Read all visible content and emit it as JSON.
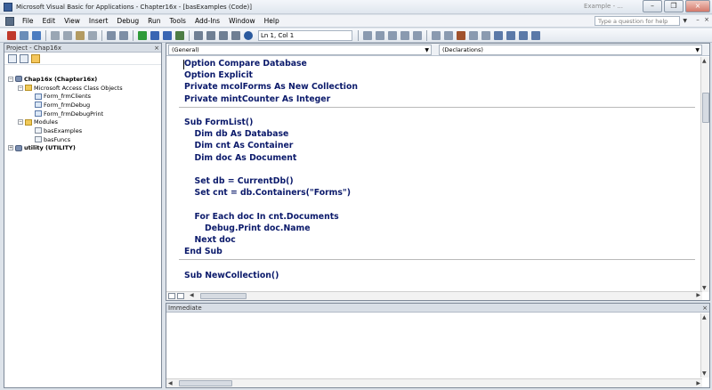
{
  "window": {
    "title": "Microsoft Visual Basic for Applications - Chapter16x - [basExamples (Code)]",
    "titlebar_right": "Example - ..."
  },
  "menu": {
    "items": [
      "File",
      "Edit",
      "View",
      "Insert",
      "Debug",
      "Run",
      "Tools",
      "Add-Ins",
      "Window",
      "Help"
    ],
    "ask_placeholder": "Type a question for help",
    "doc_buttons": [
      "–",
      "×"
    ]
  },
  "toolbar": {
    "position": "Ln 1, Col 1"
  },
  "project_pane": {
    "title": "Project - Chap16x",
    "close": "×",
    "tree": [
      {
        "label": "Chap16x (Chapter16x)",
        "level": 0,
        "icon": "project-icon",
        "toggle": "−",
        "bold": true
      },
      {
        "label": "Microsoft Access Class Objects",
        "level": 1,
        "icon": "folder-icon",
        "toggle": "−",
        "bold": false
      },
      {
        "label": "Form_frmClients",
        "level": 2,
        "icon": "form-icon",
        "toggle": "",
        "bold": false
      },
      {
        "label": "Form_frmDebug",
        "level": 2,
        "icon": "form-icon",
        "toggle": "",
        "bold": false
      },
      {
        "label": "Form_frmDebugPrint",
        "level": 2,
        "icon": "form-icon",
        "toggle": "",
        "bold": false
      },
      {
        "label": "Modules",
        "level": 1,
        "icon": "folder-icon",
        "toggle": "−",
        "bold": false
      },
      {
        "label": "basExamples",
        "level": 2,
        "icon": "module-icon",
        "toggle": "",
        "bold": false
      },
      {
        "label": "basFuncs",
        "level": 2,
        "icon": "module-icon",
        "toggle": "",
        "bold": false
      },
      {
        "label": "utility (UTILITY)",
        "level": 0,
        "icon": "project-icon",
        "toggle": "+",
        "bold": true
      }
    ]
  },
  "code_window": {
    "object_combo": "(General)",
    "proc_combo": "(Declarations)",
    "lines": [
      {
        "text": "Option Compare Database",
        "indent": 0
      },
      {
        "text": "Option Explicit",
        "indent": 0
      },
      {
        "text": "Private mcolForms As New Collection",
        "indent": 0
      },
      {
        "text": "Private mintCounter As Integer",
        "indent": 0
      },
      {
        "text": "",
        "indent": 0
      },
      {
        "text": "Sub FormList()",
        "indent": 0
      },
      {
        "text": "Dim db As Database",
        "indent": 1
      },
      {
        "text": "Dim cnt As Container",
        "indent": 1
      },
      {
        "text": "Dim doc As Document",
        "indent": 1
      },
      {
        "text": "",
        "indent": 0
      },
      {
        "text": "Set db = CurrentDb()",
        "indent": 1
      },
      {
        "text": "Set cnt = db.Containers(\"Forms\")",
        "indent": 1
      },
      {
        "text": "",
        "indent": 0
      },
      {
        "text": "For Each doc In cnt.Documents",
        "indent": 1
      },
      {
        "text": "Debug.Print doc.Name",
        "indent": 2
      },
      {
        "text": "Next doc",
        "indent": 1
      },
      {
        "text": "End Sub",
        "indent": 0
      },
      {
        "text": "",
        "indent": 0
      },
      {
        "text": "Sub NewCollection()",
        "indent": 0
      }
    ]
  },
  "immediate_window": {
    "title": "Immediate",
    "close": "×"
  }
}
